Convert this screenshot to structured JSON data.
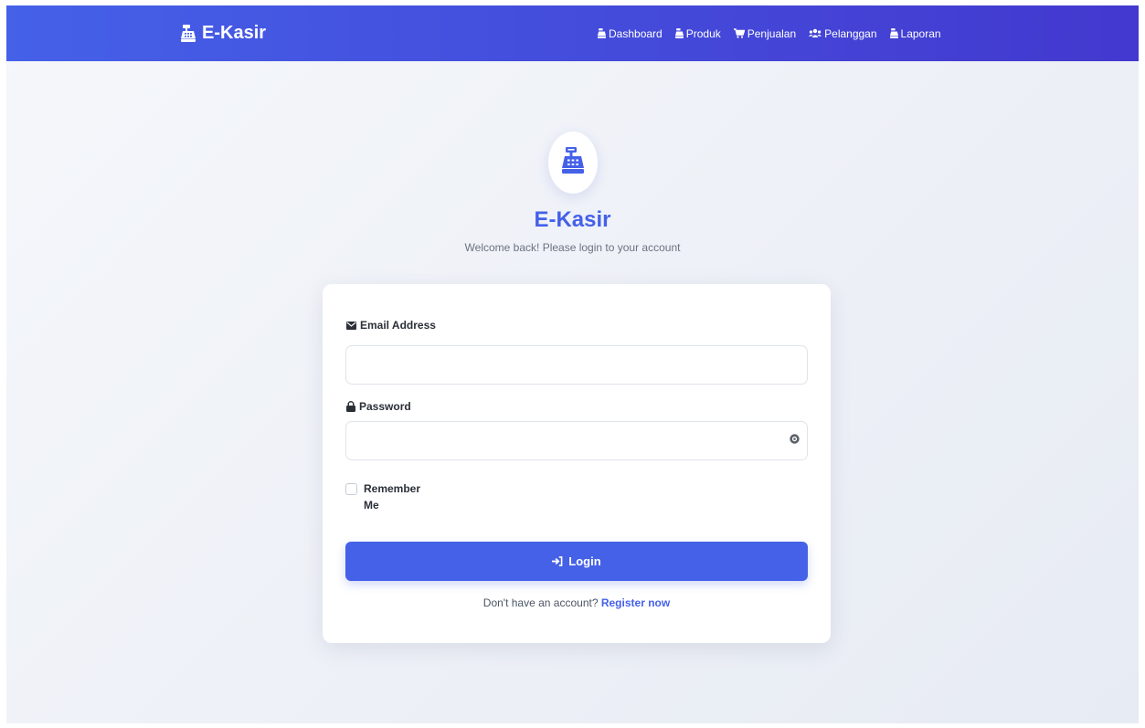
{
  "brand": {
    "name": "E-Kasir",
    "icon": "cash-register-icon"
  },
  "nav": {
    "items": [
      {
        "label": "Dashboard",
        "icon": "cash-register-icon"
      },
      {
        "label": "Produk",
        "icon": "cash-register-icon"
      },
      {
        "label": "Penjualan",
        "icon": "cart-icon"
      },
      {
        "label": "Pelanggan",
        "icon": "users-icon"
      },
      {
        "label": "Laporan",
        "icon": "cash-register-icon"
      }
    ]
  },
  "hero": {
    "title": "E-Kasir",
    "subtitle": "Welcome back! Please login to your account",
    "icon": "cash-register-icon"
  },
  "form": {
    "email": {
      "label": "Email Address",
      "value": "",
      "placeholder": "",
      "icon": "envelope-icon"
    },
    "password": {
      "label": "Password",
      "value": "",
      "placeholder": "",
      "icon": "lock-icon",
      "toggle_icon": "eye-icon"
    },
    "remember": {
      "label": "Remember Me",
      "checked": false
    },
    "submit": {
      "label": "Login",
      "icon": "sign-in-icon"
    },
    "register": {
      "prompt": "Don't have an account?",
      "link": "Register now"
    }
  },
  "colors": {
    "primary": "#4561e8",
    "navbar_start": "#4561e8",
    "navbar_end": "#4338cf",
    "background": "#eef1f6",
    "card": "#ffffff"
  }
}
